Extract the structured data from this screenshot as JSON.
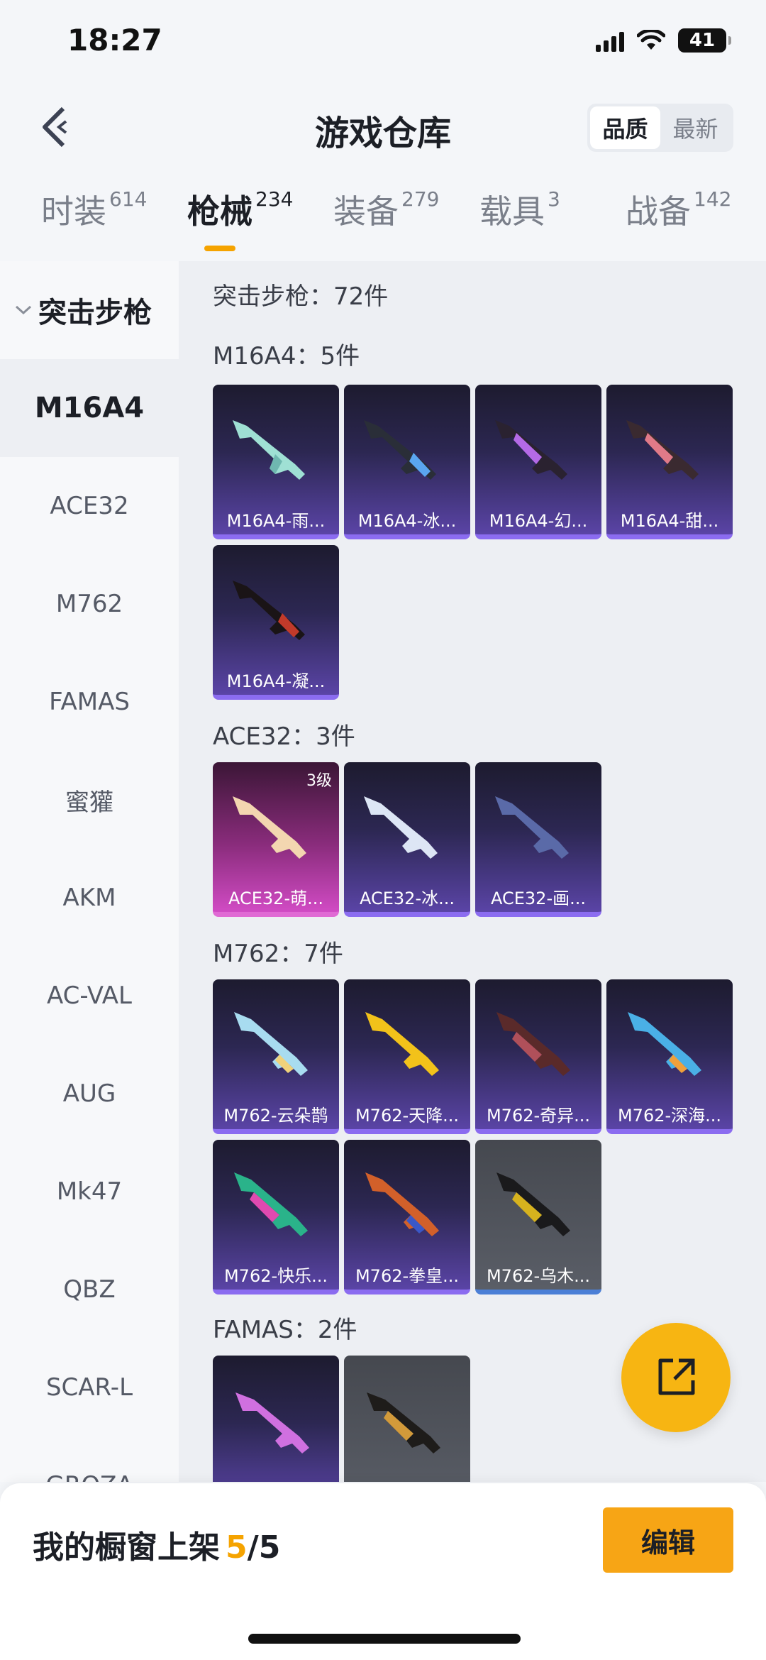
{
  "status": {
    "time": "18:27",
    "battery": "41"
  },
  "header": {
    "title": "游戏仓库",
    "sort_options": [
      "品质",
      "最新"
    ],
    "active_sort": 0
  },
  "tabs": [
    {
      "label": "时装",
      "count": "614"
    },
    {
      "label": "枪械",
      "count": "234"
    },
    {
      "label": "装备",
      "count": "279"
    },
    {
      "label": "载具",
      "count": "3"
    },
    {
      "label": "战备",
      "count": "142"
    }
  ],
  "sidebar": {
    "group": "突击步枪",
    "items": [
      "M16A4",
      "ACE32",
      "M762",
      "FAMAS",
      "蜜獾",
      "AKM",
      "AC-VAL",
      "AUG",
      "Mk47",
      "QBZ",
      "SCAR-L",
      "GROZA"
    ]
  },
  "content": {
    "summary": "突击步枪：72件",
    "sections": [
      {
        "title": "M16A4：5件",
        "items": [
          "M16A4-雨...",
          "M16A4-冰...",
          "M16A4-幻...",
          "M16A4-甜...",
          "M16A4-凝..."
        ]
      },
      {
        "title": "ACE32：3件",
        "items": [
          "ACE32-萌...",
          "ACE32-冰...",
          "ACE32-画..."
        ],
        "badge": "3级"
      },
      {
        "title": "M762：7件",
        "items": [
          "M762-云朵鹊",
          "M762-天降...",
          "M762-奇异...",
          "M762-深海...",
          "M762-快乐...",
          "M762-拳皇...",
          "M762-乌木..."
        ]
      },
      {
        "title": "FAMAS：2件",
        "items": [
          "",
          ""
        ]
      }
    ]
  },
  "bottom": {
    "showcase_label": "我的橱窗上架",
    "current": "5",
    "total": "/5",
    "edit": "编辑"
  },
  "colors": {
    "accent": "#f5a300",
    "purple_card": "#5a44a6",
    "pink_card": "#d14bc4"
  }
}
